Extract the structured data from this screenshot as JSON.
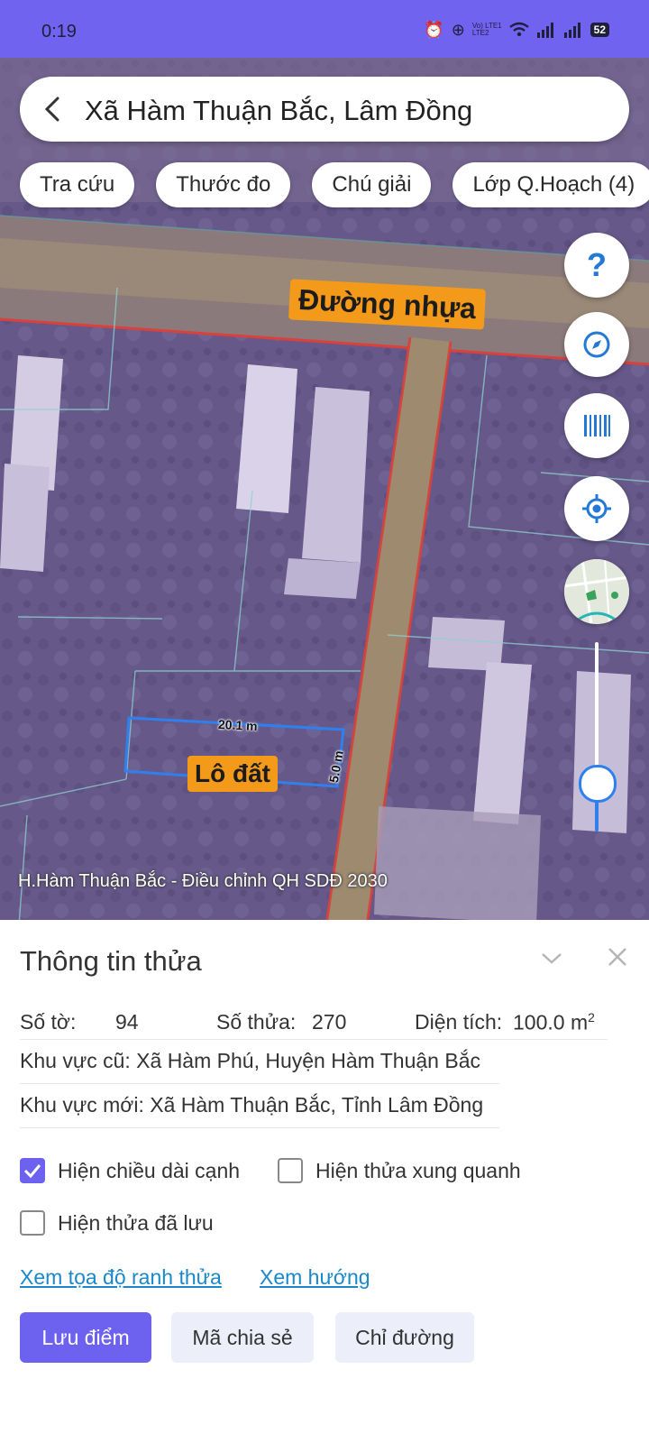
{
  "status_bar": {
    "time": "0:19",
    "network_type_top": "Vo) LTE1",
    "network_type_bottom": "LTE2",
    "battery": "52",
    "icons": [
      "alarm-icon",
      "data-saver-icon",
      "volte-icon",
      "wifi-icon",
      "signal-icon",
      "signal-icon",
      "battery-icon"
    ]
  },
  "search": {
    "title": "Xã Hàm Thuận Bắc, Lâm Đồng"
  },
  "chips": [
    {
      "label": "Tra cứu"
    },
    {
      "label": "Thước đo"
    },
    {
      "label": "Chú giải"
    },
    {
      "label": "Lớp Q.Hoạch (4)"
    }
  ],
  "map": {
    "road_label": "Đường nhựa",
    "plot_label": "Lô đất",
    "edge_length": "20.1 m",
    "edge_width": "5.0 m",
    "caption": "H.Hàm Thuận Bắc - Điều chỉnh QH SDĐ 2030",
    "side_buttons": [
      "help-icon",
      "compass-icon",
      "barcode-icon",
      "my-location-icon",
      "map-thumbnail"
    ],
    "zoom_level": 0.3,
    "overlay_color": "#7b5fb0",
    "plot_outline_color": "#2f80ed",
    "road_outline_color": "#e3463a"
  },
  "panel": {
    "title": "Thông tin thửa",
    "sheet_label": "Số tờ:",
    "sheet_value": "94",
    "parcel_label": "Số thửa:",
    "parcel_value": "270",
    "area_label": "Diện tích:",
    "area_value": "100.0 m",
    "area_unit_sup": "2",
    "old_area": "Khu vực cũ: Xã Hàm Phú, Huyện Hàm Thuận Bắc",
    "new_area": "Khu vực mới: Xã Hàm Thuận Bắc, Tỉnh Lâm Đồng",
    "checkboxes": [
      {
        "label": "Hiện chiều dài cạnh",
        "checked": true
      },
      {
        "label": "Hiện thửa xung quanh",
        "checked": false
      },
      {
        "label": "Hiện thửa đã lưu",
        "checked": false
      }
    ],
    "links": [
      "Xem tọa độ ranh thửa",
      "Xem hướng"
    ],
    "buttons": {
      "save": "Lưu điểm",
      "share": "Mã chia sẻ",
      "directions": "Chỉ đường"
    }
  },
  "colors": {
    "accent": "#6d62f0",
    "link": "#1a88c9",
    "tag": "#f39a1a"
  }
}
